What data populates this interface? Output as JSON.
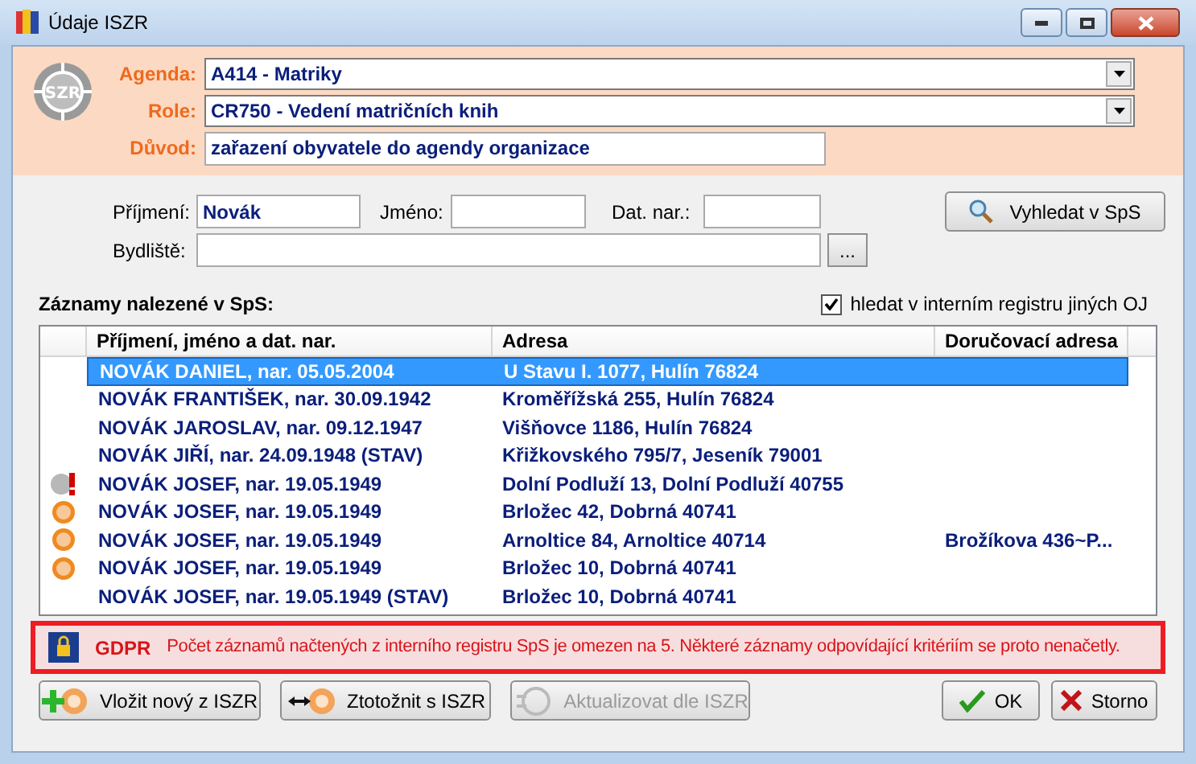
{
  "window": {
    "title": "Údaje ISZR"
  },
  "header": {
    "agenda": {
      "label": "Agenda:",
      "value": "A414 - Matriky"
    },
    "role": {
      "label": "Role:",
      "value": "CR750 - Vedení matričních knih"
    },
    "reason": {
      "label": "Důvod:",
      "value": "zařazení obyvatele do agendy organizace"
    },
    "logo": "SZR"
  },
  "search": {
    "surname": {
      "label": "Příjmení:",
      "value": "Novák"
    },
    "first_name": {
      "label": "Jméno:"
    },
    "birth_date": {
      "label": "Dat. nar.:"
    },
    "address": {
      "label": "Bydliště:"
    },
    "browse_button": "...",
    "search_button": "Vyhledat v SpS"
  },
  "results": {
    "title": "Záznamy nalezené v SpS:",
    "other_units": {
      "label": "hledat v interním registru jiných OJ",
      "checked": true
    },
    "columns": [
      "Příjmení, jméno a dat. nar.",
      "Adresa",
      "Doručovací adresa"
    ],
    "rows": [
      {
        "kind": "none",
        "name": "NOVÁK DANIEL, nar. 05.05.2004",
        "address": "U Stavu I. 1077, Hulín 76824",
        "selected": true
      },
      {
        "kind": "none",
        "name": "NOVÁK FRANTIŠEK, nar. 30.09.1942",
        "address": "Kroměřížská 255, Hulín 76824",
        "selected": false
      },
      {
        "kind": "none",
        "name": "NOVÁK JAROSLAV, nar. 09.12.1947",
        "address": "Višňovce 1186, Hulín 76824",
        "selected": false
      },
      {
        "kind": "none",
        "name": "NOVÁK JIŘÍ, nar. 24.09.1948 (STAV)",
        "address": "Křižkovského 795/7, Jeseník 79001",
        "selected": false
      },
      {
        "kind": "warning",
        "name": "NOVÁK JOSEF, nar. 19.05.1949",
        "address": "Dolní Podluží 13, Dolní Podluží 40755",
        "selected": false
      },
      {
        "kind": "linked",
        "name": "NOVÁK JOSEF, nar. 19.05.1949",
        "address": "Brložec 42, Dobrná 40741",
        "selected": false
      },
      {
        "kind": "linked",
        "name": "NOVÁK JOSEF, nar. 19.05.1949",
        "address": "Arnoltice 84, Arnoltice 40714",
        "delivery": "Brožíkova 436~P...",
        "selected": false
      },
      {
        "kind": "linked",
        "name": "NOVÁK JOSEF, nar. 19.05.1949",
        "address": "Brložec 10, Dobrná 40741",
        "selected": false
      },
      {
        "kind": "none",
        "name": "NOVÁK JOSEF, nar. 19.05.1949 (STAV)",
        "address": "Brložec 10, Dobrná 40741",
        "selected": false
      }
    ]
  },
  "notice": {
    "tag": "GDPR",
    "text": "Počet záznamů načtených z interního registru SpS je omezen na 5. Některé záznamy odpovídající kritériím se proto nenačetly."
  },
  "buttons": [
    {
      "kind": "insert",
      "label": "Vložit nový z ISZR",
      "disabled": false
    },
    {
      "kind": "identify",
      "label": "Ztotožnit s ISZR",
      "disabled": false
    },
    {
      "kind": "update",
      "label": "Aktualizovat dle ISZR",
      "disabled": true
    },
    {
      "kind": "ok",
      "label": "OK",
      "disabled": false
    },
    {
      "kind": "cancel",
      "label": "Storno",
      "disabled": false
    }
  ]
}
